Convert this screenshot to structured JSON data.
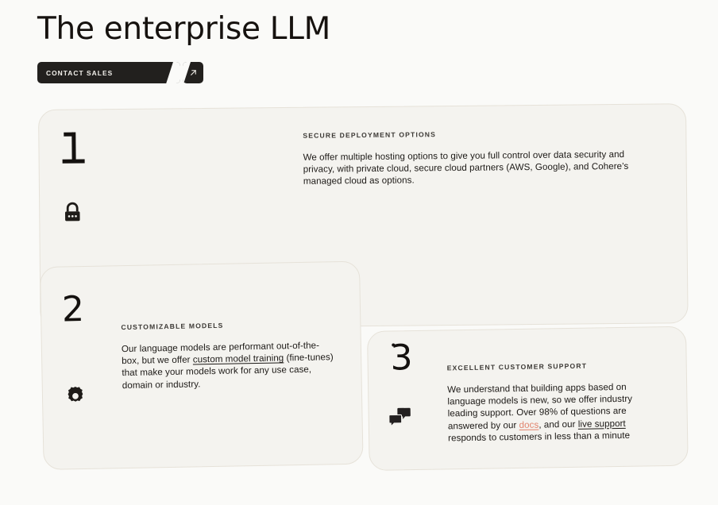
{
  "page": {
    "title": "The enterprise LLM",
    "background_color": "#FAFAF8",
    "card_color": "#F4F3EF",
    "card_border_color": "#E6E2D9",
    "text_color": "#14110F",
    "accent_color": "#E2836C"
  },
  "cta": {
    "label": "CONTACT SALES",
    "arrow_icon": "arrow-up-right-icon",
    "background_color": "#22201E",
    "label_color": "#F3F1EC"
  },
  "cards": [
    {
      "number": "1",
      "eyebrow": "SECURE DEPLOYMENT OPTIONS",
      "icon": "lock-icon",
      "body_parts": [
        {
          "type": "text",
          "value": "We offer multiple hosting options to give you full control over data security and privacy, with private cloud, secure cloud partners (AWS, Google), and Cohere’s managed cloud as options."
        }
      ]
    },
    {
      "number": "2",
      "eyebrow": "CUSTOMIZABLE MODELS",
      "icon": "gear-icon",
      "body_parts": [
        {
          "type": "text",
          "value": "Our language models are performant out-of-the-box, but we offer "
        },
        {
          "type": "link",
          "value": "custom model training",
          "style": "plain"
        },
        {
          "type": "text",
          "value": " (fine-tunes) that make your models work for any use case, domain or industry."
        }
      ]
    },
    {
      "number": "3",
      "eyebrow": "EXCELLENT CUSTOMER SUPPORT",
      "icon": "chat-bubbles-icon",
      "body_parts": [
        {
          "type": "text",
          "value": "We understand that building apps based on language models is new, so we offer industry leading support. Over 98% of questions are answered by our "
        },
        {
          "type": "link",
          "value": "docs",
          "style": "accent"
        },
        {
          "type": "text",
          "value": ", and our "
        },
        {
          "type": "link",
          "value": "live support",
          "style": "plain"
        },
        {
          "type": "text",
          "value": " responds to customers in less than a minute"
        }
      ]
    }
  ]
}
